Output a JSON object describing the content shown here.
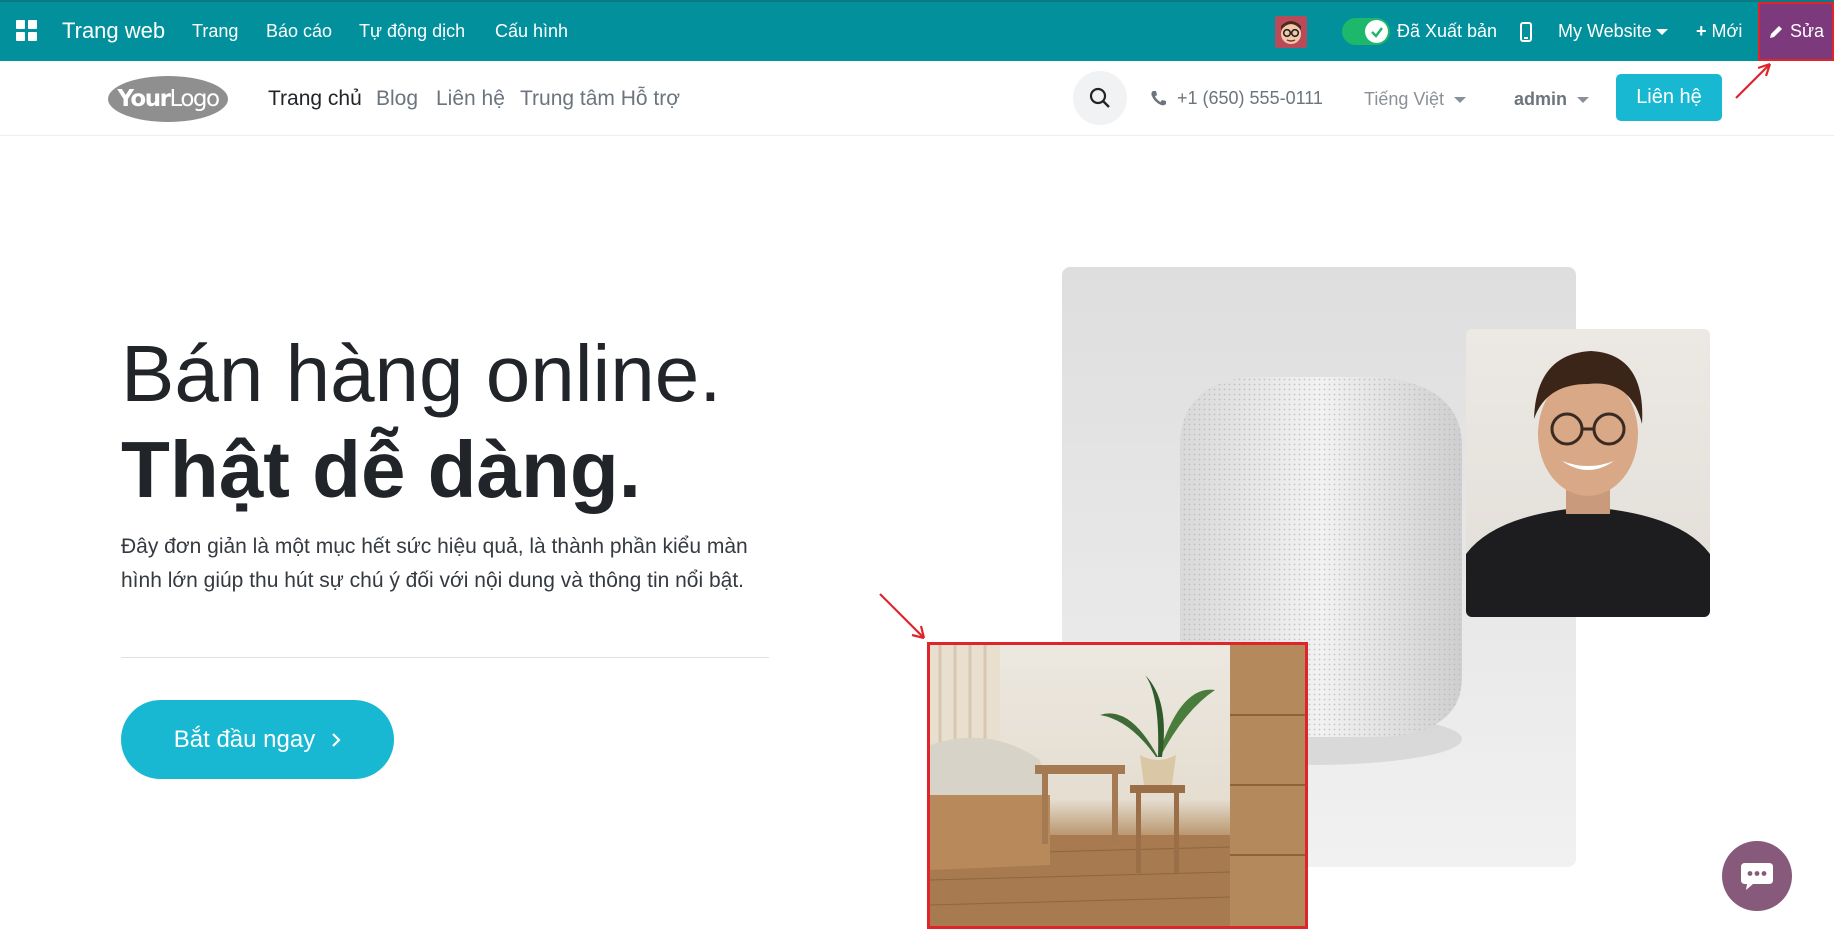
{
  "adminbar": {
    "brand": "Trang web",
    "menu": [
      "Trang",
      "Báo cáo",
      "Tự động dịch",
      "Cấu hình"
    ],
    "published_label": "Đã Xuất bản",
    "website_label": "My Website",
    "new_label": "Mới",
    "edit_label": "Sửa"
  },
  "header": {
    "logo_bold": "Your",
    "logo_light": "Logo",
    "nav": [
      "Trang chủ",
      "Blog",
      "Liên hệ",
      "Trung tâm Hỗ trợ"
    ],
    "phone": "+1 (650) 555-0111",
    "language": "Tiếng Việt",
    "user": "admin",
    "contact_label": "Liên hệ"
  },
  "hero": {
    "title_line1": "Bán hàng online.",
    "title_line2": "Thật dễ dàng.",
    "lead": "Đây đơn giản là một mục hết sức hiệu quả, là thành phần kiểu màn hình lớn giúp thu hút sự chú ý đối với nội dung và thông tin nổi bật.",
    "cta_label": "Bắt đầu ngay"
  },
  "colors": {
    "adminbar": "#02909c",
    "edit_button": "#7c3a7c",
    "accent": "#18b8d3",
    "chat": "#875a7b",
    "annotation": "#e0242b"
  },
  "icons": [
    "apps-grid-icon",
    "check-icon",
    "mobile-icon",
    "plus-icon",
    "pencil-icon",
    "search-icon",
    "phone-icon",
    "chevron-right-icon",
    "chat-icon"
  ]
}
